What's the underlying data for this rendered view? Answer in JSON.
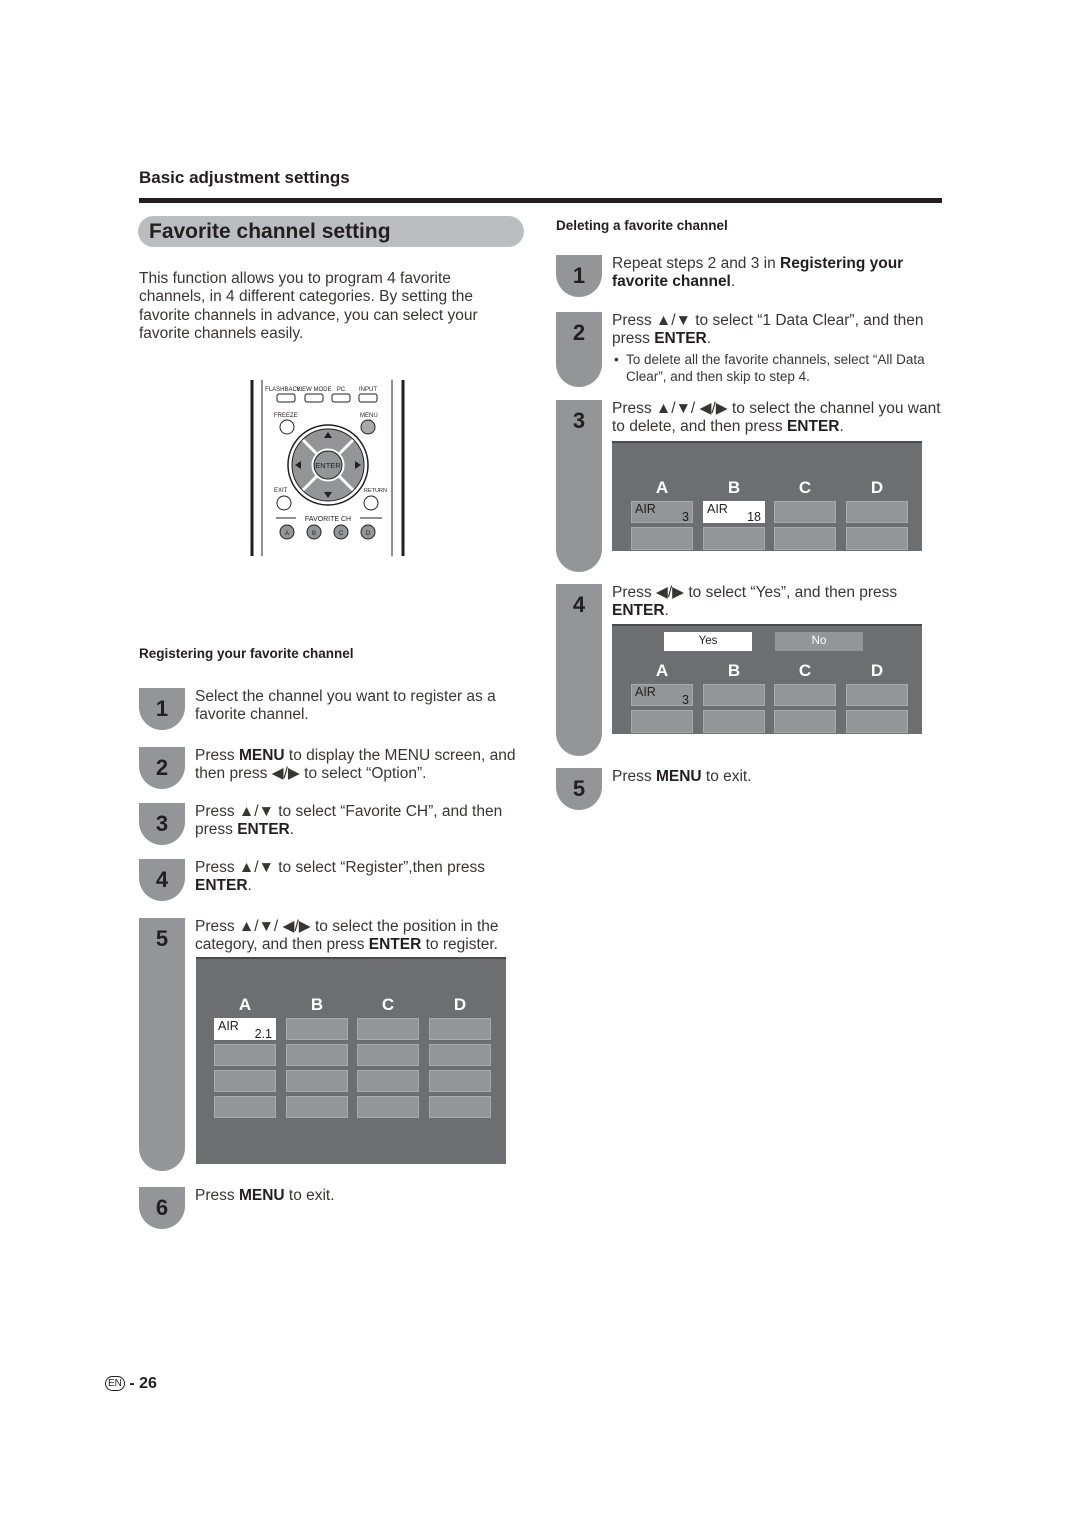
{
  "header": {
    "section": "Basic adjustment settings",
    "title": "Favorite channel setting"
  },
  "intro": "This function allows you to program 4 favorite channels, in 4 different categories. By setting the favorite channels in advance, you can select your favorite channels easily.",
  "remote": {
    "top_buttons": [
      "FLASHBACK",
      "VIEW MODE",
      "PC",
      "INPUT"
    ],
    "freeze": "FREEZE",
    "menu": "MENU",
    "enter": "ENTER",
    "exit": "EXIT",
    "return": "RETURN",
    "favorite_label": "FAVORITE CH",
    "favorite_buttons": [
      "A",
      "B",
      "C",
      "D"
    ]
  },
  "registering": {
    "heading": "Registering your favorite channel",
    "steps": [
      {
        "num": "1",
        "parts": [
          {
            "t": "Select the channel you want to register as a favorite channel."
          }
        ]
      },
      {
        "num": "2",
        "parts": [
          {
            "t": "Press "
          },
          {
            "b": "MENU"
          },
          {
            "t": " to display the MENU screen, and then press ◀/▶ to select “Option”."
          }
        ]
      },
      {
        "num": "3",
        "parts": [
          {
            "t": "Press ▲/▼ to select “Favorite CH”, and then press "
          },
          {
            "b": "ENTER"
          },
          {
            "t": "."
          }
        ]
      },
      {
        "num": "4",
        "parts": [
          {
            "t": "Press ▲/▼ to select “Register”,then press "
          },
          {
            "b": "ENTER"
          },
          {
            "t": "."
          }
        ]
      },
      {
        "num": "5",
        "parts": [
          {
            "t": "Press ▲/▼/ ◀/▶ to select the position in the category, and then press "
          },
          {
            "b": "ENTER"
          },
          {
            "t": " to register."
          }
        ]
      },
      {
        "num": "6",
        "parts": [
          {
            "t": "Press "
          },
          {
            "b": "MENU"
          },
          {
            "t": " to exit."
          }
        ]
      }
    ],
    "screen": {
      "columns": [
        "A",
        "B",
        "C",
        "D"
      ],
      "selected_cell": {
        "band": "AIR",
        "channel": "2.1"
      }
    }
  },
  "deleting": {
    "heading": "Deleting a favorite channel",
    "steps": [
      {
        "num": "1",
        "parts": [
          {
            "t": "Repeat steps 2 and 3 in "
          },
          {
            "b": "Registering your favorite channel"
          },
          {
            "t": "."
          }
        ]
      },
      {
        "num": "2",
        "parts": [
          {
            "t": "Press ▲/▼ to select “1 Data Clear”, and then press "
          },
          {
            "b": "ENTER"
          },
          {
            "t": "."
          }
        ],
        "note": "To delete all the favorite channels, select “All Data Clear”, and then skip to step 4."
      },
      {
        "num": "3",
        "parts": [
          {
            "t": "Press ▲/▼/ ◀/▶ to select the channel you want to delete, and then press "
          },
          {
            "b": "ENTER"
          },
          {
            "t": "."
          }
        ]
      },
      {
        "num": "4",
        "parts": [
          {
            "t": "Press ◀/▶ to select “Yes”, and then press "
          },
          {
            "b": "ENTER"
          },
          {
            "t": "."
          }
        ]
      },
      {
        "num": "5",
        "parts": [
          {
            "t": "Press "
          },
          {
            "b": "MENU"
          },
          {
            "t": " to exit."
          }
        ]
      }
    ],
    "screen3": {
      "columns": [
        "A",
        "B",
        "C",
        "D"
      ],
      "cells": [
        {
          "band": "AIR",
          "channel": "3"
        },
        {
          "band": "AIR",
          "channel": "18",
          "selected": true
        }
      ]
    },
    "screen4": {
      "yes": "Yes",
      "no": "No",
      "columns": [
        "A",
        "B",
        "C",
        "D"
      ],
      "cells": [
        {
          "band": "AIR",
          "channel": "3"
        }
      ]
    }
  },
  "footer": {
    "lang": "EN",
    "separator": "-",
    "page": "26"
  }
}
